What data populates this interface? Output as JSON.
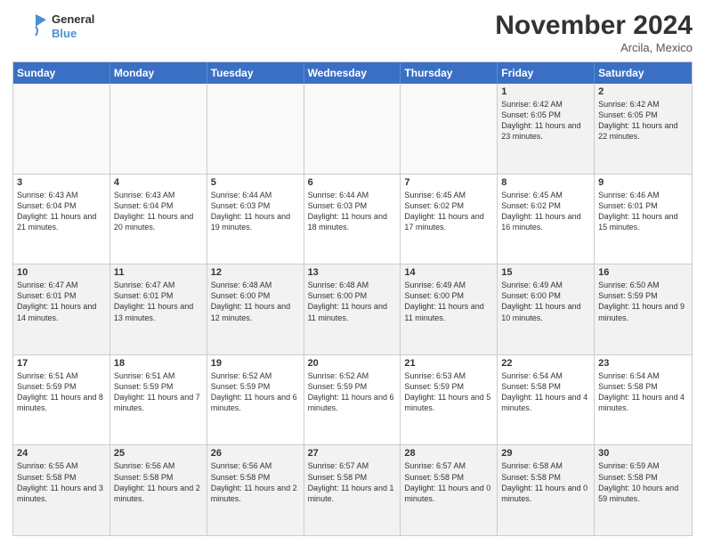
{
  "logo": {
    "text_general": "General",
    "text_blue": "Blue"
  },
  "header": {
    "month": "November 2024",
    "location": "Arcila, Mexico"
  },
  "days_of_week": [
    "Sunday",
    "Monday",
    "Tuesday",
    "Wednesday",
    "Thursday",
    "Friday",
    "Saturday"
  ],
  "weeks": [
    [
      {
        "day": "",
        "empty": true
      },
      {
        "day": "",
        "empty": true
      },
      {
        "day": "",
        "empty": true
      },
      {
        "day": "",
        "empty": true
      },
      {
        "day": "",
        "empty": true
      },
      {
        "day": "1",
        "sunrise": "6:42 AM",
        "sunset": "6:05 PM",
        "daylight": "11 hours and 23 minutes."
      },
      {
        "day": "2",
        "sunrise": "6:42 AM",
        "sunset": "6:05 PM",
        "daylight": "11 hours and 22 minutes."
      }
    ],
    [
      {
        "day": "3",
        "sunrise": "6:43 AM",
        "sunset": "6:04 PM",
        "daylight": "11 hours and 21 minutes."
      },
      {
        "day": "4",
        "sunrise": "6:43 AM",
        "sunset": "6:04 PM",
        "daylight": "11 hours and 20 minutes."
      },
      {
        "day": "5",
        "sunrise": "6:44 AM",
        "sunset": "6:03 PM",
        "daylight": "11 hours and 19 minutes."
      },
      {
        "day": "6",
        "sunrise": "6:44 AM",
        "sunset": "6:03 PM",
        "daylight": "11 hours and 18 minutes."
      },
      {
        "day": "7",
        "sunrise": "6:45 AM",
        "sunset": "6:02 PM",
        "daylight": "11 hours and 17 minutes."
      },
      {
        "day": "8",
        "sunrise": "6:45 AM",
        "sunset": "6:02 PM",
        "daylight": "11 hours and 16 minutes."
      },
      {
        "day": "9",
        "sunrise": "6:46 AM",
        "sunset": "6:01 PM",
        "daylight": "11 hours and 15 minutes."
      }
    ],
    [
      {
        "day": "10",
        "sunrise": "6:47 AM",
        "sunset": "6:01 PM",
        "daylight": "11 hours and 14 minutes."
      },
      {
        "day": "11",
        "sunrise": "6:47 AM",
        "sunset": "6:01 PM",
        "daylight": "11 hours and 13 minutes."
      },
      {
        "day": "12",
        "sunrise": "6:48 AM",
        "sunset": "6:00 PM",
        "daylight": "11 hours and 12 minutes."
      },
      {
        "day": "13",
        "sunrise": "6:48 AM",
        "sunset": "6:00 PM",
        "daylight": "11 hours and 11 minutes."
      },
      {
        "day": "14",
        "sunrise": "6:49 AM",
        "sunset": "6:00 PM",
        "daylight": "11 hours and 11 minutes."
      },
      {
        "day": "15",
        "sunrise": "6:49 AM",
        "sunset": "6:00 PM",
        "daylight": "11 hours and 10 minutes."
      },
      {
        "day": "16",
        "sunrise": "6:50 AM",
        "sunset": "5:59 PM",
        "daylight": "11 hours and 9 minutes."
      }
    ],
    [
      {
        "day": "17",
        "sunrise": "6:51 AM",
        "sunset": "5:59 PM",
        "daylight": "11 hours and 8 minutes."
      },
      {
        "day": "18",
        "sunrise": "6:51 AM",
        "sunset": "5:59 PM",
        "daylight": "11 hours and 7 minutes."
      },
      {
        "day": "19",
        "sunrise": "6:52 AM",
        "sunset": "5:59 PM",
        "daylight": "11 hours and 6 minutes."
      },
      {
        "day": "20",
        "sunrise": "6:52 AM",
        "sunset": "5:59 PM",
        "daylight": "11 hours and 6 minutes."
      },
      {
        "day": "21",
        "sunrise": "6:53 AM",
        "sunset": "5:59 PM",
        "daylight": "11 hours and 5 minutes."
      },
      {
        "day": "22",
        "sunrise": "6:54 AM",
        "sunset": "5:58 PM",
        "daylight": "11 hours and 4 minutes."
      },
      {
        "day": "23",
        "sunrise": "6:54 AM",
        "sunset": "5:58 PM",
        "daylight": "11 hours and 4 minutes."
      }
    ],
    [
      {
        "day": "24",
        "sunrise": "6:55 AM",
        "sunset": "5:58 PM",
        "daylight": "11 hours and 3 minutes."
      },
      {
        "day": "25",
        "sunrise": "6:56 AM",
        "sunset": "5:58 PM",
        "daylight": "11 hours and 2 minutes."
      },
      {
        "day": "26",
        "sunrise": "6:56 AM",
        "sunset": "5:58 PM",
        "daylight": "11 hours and 2 minutes."
      },
      {
        "day": "27",
        "sunrise": "6:57 AM",
        "sunset": "5:58 PM",
        "daylight": "11 hours and 1 minute."
      },
      {
        "day": "28",
        "sunrise": "6:57 AM",
        "sunset": "5:58 PM",
        "daylight": "11 hours and 0 minutes."
      },
      {
        "day": "29",
        "sunrise": "6:58 AM",
        "sunset": "5:58 PM",
        "daylight": "11 hours and 0 minutes."
      },
      {
        "day": "30",
        "sunrise": "6:59 AM",
        "sunset": "5:58 PM",
        "daylight": "10 hours and 59 minutes."
      }
    ]
  ]
}
